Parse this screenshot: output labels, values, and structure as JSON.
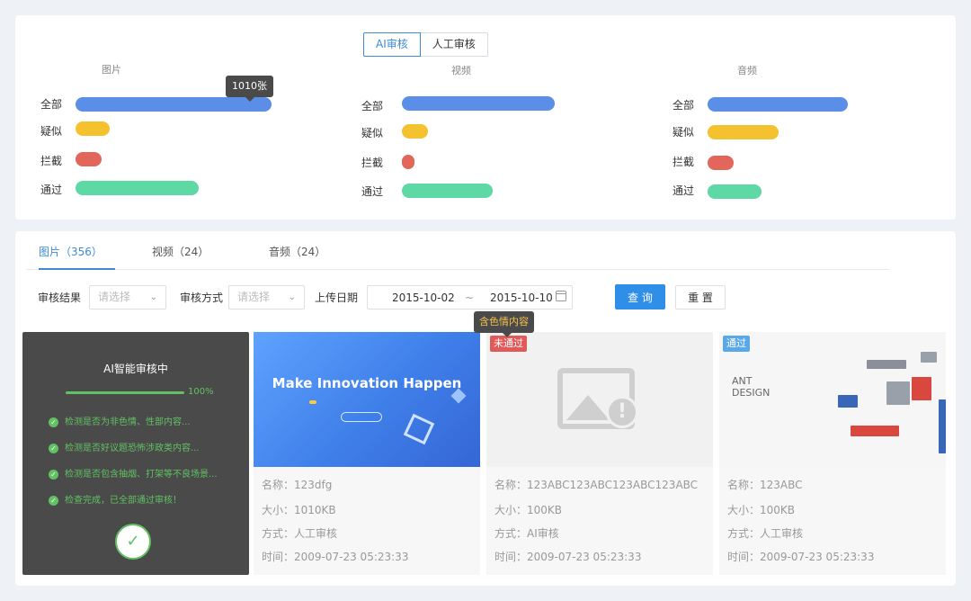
{
  "mode_toggle": [
    "AI审核",
    "人工审核"
  ],
  "stats": {
    "row_labels": [
      "全部",
      "疑似",
      "拦截",
      "通过"
    ],
    "groups": [
      {
        "title": "图片",
        "fractions": [
          0.91,
          0.16,
          0.12,
          0.57
        ]
      },
      {
        "title": "视频",
        "fractions": [
          0.71,
          0.12,
          0.06,
          0.42
        ]
      },
      {
        "title": "音频",
        "fractions": [
          0.65,
          0.33,
          0.12,
          0.25
        ]
      }
    ],
    "tooltip": "1010张"
  },
  "tabs": [
    "图片（356）",
    "视频（24）",
    "音频（24）"
  ],
  "filters": {
    "review_result_label": "审核结果",
    "review_result_placeholder": "请选择",
    "review_mode_label": "审核方式",
    "review_mode_placeholder": "请选择",
    "upload_date_label": "上传日期",
    "date_start": "2015-10-02",
    "date_sep": "~",
    "date_end": "2015-10-10",
    "query_button": "查 询",
    "reset_button": "重 置"
  },
  "warning_tooltip": "含色情内容",
  "progress": {
    "title": "AI智能审核中",
    "percent": "100%",
    "value": 1.0,
    "checks": [
      "检测是否为非色情、性部内容...",
      "检测是否好议题恐怖涉政类内容...",
      "检测是否包含抽烟、打架等不良场景...",
      "检查完成，已全部通过审核！"
    ]
  },
  "cards": [
    {
      "badge": "",
      "thumb_title": "Make Innovation Happen",
      "name": "名称：123dfg",
      "size": "大小：1010KB",
      "mode": "方式：人工审核",
      "time": "时间：2009-07-23 05:23:33"
    },
    {
      "badge": "未通过",
      "name": "名称：123ABC123ABC123ABC123ABC",
      "size": "大小：100KB",
      "mode": "方式：AI审核",
      "time": "时间：2009-07-23 05:23:33"
    },
    {
      "badge": "通过",
      "thumb_brand": "ANT DESIGN",
      "name": "名称：123ABC",
      "size": "大小：100KB",
      "mode": "方式：人工审核",
      "time": "时间：2009-07-23 05:23:33"
    }
  ],
  "colors": {
    "accent": "#2f8ee8",
    "all": "#5b8ee6",
    "suspect": "#f5c22f",
    "blocked": "#e2675a",
    "passed": "#5ed8a5",
    "progress_green": "#61c163"
  }
}
